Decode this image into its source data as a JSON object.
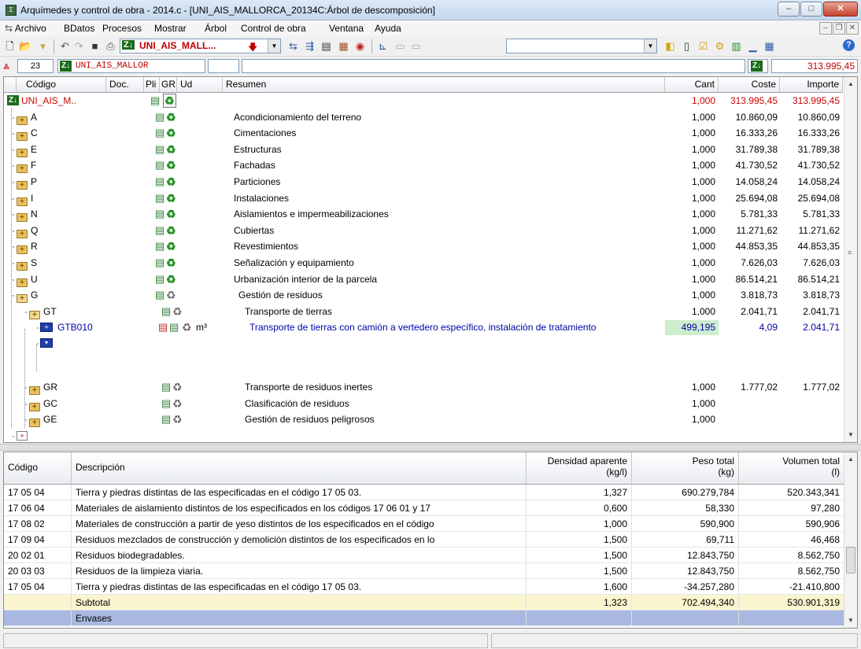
{
  "window": {
    "title": "Arquímedes y control de obra - 2014.c - [UNI_AIS_MALLORCA_20134C:Árbol de descomposición]",
    "minimize": "–",
    "maximize": "□",
    "close": "✕"
  },
  "menu": {
    "items": [
      "Archivo",
      "BDatos",
      "Procesos",
      "Mostrar",
      "Árbol",
      "Control de obra",
      "Ventana",
      "Ayuda"
    ],
    "mdi_min": "–",
    "mdi_restore": "❐",
    "mdi_close": "✕"
  },
  "toolbar": {
    "project_combo": "UNI_AIS_MALL...",
    "help": "?"
  },
  "navbar": {
    "counter": "23",
    "root_code": "UNI_AIS_MALLOR",
    "total": "313.995,45"
  },
  "tree": {
    "columns": {
      "codigo": "Código",
      "doc": "Doc.",
      "pli": "Pli",
      "gr": "GR",
      "ud": "Ud",
      "resumen": "Resumen",
      "cant": "Cant",
      "coste": "Coste",
      "importe": "Importe"
    },
    "rows": [
      {
        "code": "UNI_AIS_M..",
        "ud": "",
        "resumen": "",
        "cant": "1,000",
        "coste": "313.995,45",
        "importe": "313.995,45"
      },
      {
        "code": "A",
        "ud": "",
        "resumen": "Acondicionamiento del terreno",
        "cant": "1,000",
        "coste": "10.860,09",
        "importe": "10.860,09"
      },
      {
        "code": "C",
        "ud": "",
        "resumen": "Cimentaciones",
        "cant": "1,000",
        "coste": "16.333,26",
        "importe": "16.333,26"
      },
      {
        "code": "E",
        "ud": "",
        "resumen": "Estructuras",
        "cant": "1,000",
        "coste": "31.789,38",
        "importe": "31.789,38"
      },
      {
        "code": "F",
        "ud": "",
        "resumen": "Fachadas",
        "cant": "1,000",
        "coste": "41.730,52",
        "importe": "41.730,52"
      },
      {
        "code": "P",
        "ud": "",
        "resumen": "Particiones",
        "cant": "1,000",
        "coste": "14.058,24",
        "importe": "14.058,24"
      },
      {
        "code": "I",
        "ud": "",
        "resumen": "Instalaciones",
        "cant": "1,000",
        "coste": "25.694,08",
        "importe": "25.694,08"
      },
      {
        "code": "N",
        "ud": "",
        "resumen": "Aislamientos e impermeabilizaciones",
        "cant": "1,000",
        "coste": "5.781,33",
        "importe": "5.781,33"
      },
      {
        "code": "Q",
        "ud": "",
        "resumen": "Cubiertas",
        "cant": "1,000",
        "coste": "11.271,62",
        "importe": "11.271,62"
      },
      {
        "code": "R",
        "ud": "",
        "resumen": "Revestimientos",
        "cant": "1,000",
        "coste": "44.853,35",
        "importe": "44.853,35"
      },
      {
        "code": "S",
        "ud": "",
        "resumen": "Señalización y equipamiento",
        "cant": "1,000",
        "coste": "7.626,03",
        "importe": "7.626,03"
      },
      {
        "code": "U",
        "ud": "",
        "resumen": "Urbanización interior de la parcela",
        "cant": "1,000",
        "coste": "86.514,21",
        "importe": "86.514,21"
      },
      {
        "code": "G",
        "ud": "",
        "resumen": "Gestión de residuos",
        "cant": "1,000",
        "coste": "3.818,73",
        "importe": "3.818,73"
      },
      {
        "code": "GT",
        "ud": "",
        "resumen": "Transporte de tierras",
        "cant": "1,000",
        "coste": "2.041,71",
        "importe": "2.041,71"
      },
      {
        "code": "GTB010",
        "ud": "m³",
        "resumen": "Transporte de tierras con camión a vertedero específico, instalación de tratamiento",
        "cant": "499,195",
        "coste": "4,09",
        "importe": "2.041,71"
      },
      {
        "code": "",
        "ud": "",
        "resumen": "",
        "cant": "",
        "coste": "",
        "importe": ""
      },
      {
        "code": "GR",
        "ud": "",
        "resumen": "Transporte de residuos inertes",
        "cant": "1,000",
        "coste": "1.777,02",
        "importe": "1.777,02"
      },
      {
        "code": "GC",
        "ud": "",
        "resumen": "Clasificación de residuos",
        "cant": "1,000",
        "coste": "",
        "importe": ""
      },
      {
        "code": "GE",
        "ud": "",
        "resumen": "Gestión de residuos peligrosos",
        "cant": "1,000",
        "coste": "",
        "importe": ""
      }
    ]
  },
  "waste": {
    "columns": {
      "codigo": "Código",
      "descripcion": "Descripción",
      "densidad": "Densidad aparente",
      "densidad_unit": "(kg/l)",
      "peso": "Peso total",
      "peso_unit": "(kg)",
      "volumen": "Volumen total",
      "volumen_unit": "(l)"
    },
    "rows": [
      {
        "code": "17 05 04",
        "desc": "Tierra y piedras distintas de las especificadas en el código 17 05 03.",
        "dens": "1,327",
        "peso": "690.279,784",
        "vol": "520.343,341"
      },
      {
        "code": "17 06 04",
        "desc": "Materiales de aislamiento distintos de los especificados en los códigos 17 06 01 y 17",
        "dens": "0,600",
        "peso": "58,330",
        "vol": "97,280"
      },
      {
        "code": "17 08 02",
        "desc": "Materiales de construcción a partir de yeso distintos de los especificados en el código",
        "dens": "1,000",
        "peso": "590,900",
        "vol": "590,906"
      },
      {
        "code": "17 09 04",
        "desc": "Residuos mezclados de construcción y demolición distintos de los especificados en lo",
        "dens": "1,500",
        "peso": "69,711",
        "vol": "46,468"
      },
      {
        "code": "20 02 01",
        "desc": "Residuos biodegradables.",
        "dens": "1,500",
        "peso": "12.843,750",
        "vol": "8.562,750"
      },
      {
        "code": "20 03 03",
        "desc": "Residuos de la limpieza viaria.",
        "dens": "1,500",
        "peso": "12.843,750",
        "vol": "8.562,750"
      },
      {
        "code": "17 05 04",
        "desc": "Tierra y piedras distintas de las especificadas en el código 17 05 03.",
        "dens": "1,600",
        "peso": "-34.257,280",
        "vol": "-21.410,800"
      }
    ],
    "subtotal": {
      "label": "Subtotal",
      "dens": "1,323",
      "peso": "702.494,340",
      "vol": "530.901,319"
    },
    "envases": {
      "label": "Envases"
    }
  },
  "colors": {
    "root_red": "#cc0000",
    "selected_blue": "#0000a8",
    "highlight_green": "#cdeecd",
    "subtotal_yellow": "#fbf5cf",
    "envases_blue": "#a8b8e0"
  }
}
